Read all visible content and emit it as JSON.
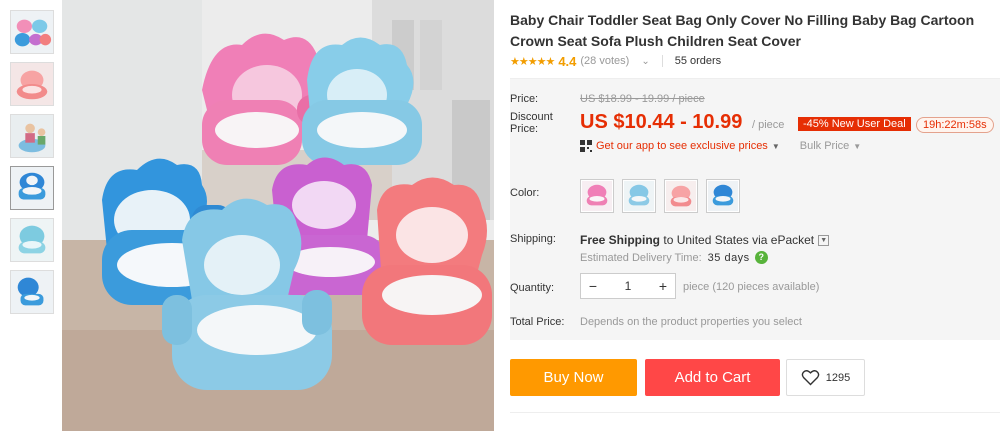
{
  "product": {
    "title": "Baby Chair Toddler Seat Bag Only Cover No Filling Baby Bag Cartoon Crown Seat Sofa Plush Children Seat Cover",
    "stars": "★★★★★",
    "rating": "4.4",
    "stars_value": 4.4,
    "votes": "(28 votes)",
    "orders": "55 orders"
  },
  "price": {
    "label": "Price:",
    "original": "US $18.99 - 19.99 / piece",
    "discount_label": "Discount Price:",
    "current": "US $10.44 - 10.99",
    "per": "/ piece",
    "badge": "-45% New User Deal",
    "timer": "19h:22m:58s"
  },
  "app_promo": {
    "text": "Get our app to see exclusive prices",
    "bulk": "Bulk Price"
  },
  "color": {
    "label": "Color:",
    "swatches": [
      "pink",
      "blue",
      "pink-chair",
      "blue-chair"
    ]
  },
  "shipping": {
    "label": "Shipping:",
    "free": "Free Shipping",
    "to": "to",
    "country": "United States",
    "via": "via ePacket",
    "est_label": "Estimated Delivery Time:",
    "est_days": "35 days"
  },
  "quantity": {
    "label": "Quantity:",
    "minus": "−",
    "value": "1",
    "plus": "+",
    "available": "piece (120 pieces available)"
  },
  "total": {
    "label": "Total Price:",
    "value": "Depends on the product properties you select"
  },
  "actions": {
    "buy": "Buy Now",
    "cart": "Add to Cart",
    "wishlist_count": "1295"
  },
  "colors": {
    "accent_red": "#e62e04",
    "buy_orange": "#ff9900",
    "cart_red": "#ff4747",
    "star_orange": "#f29d00"
  }
}
